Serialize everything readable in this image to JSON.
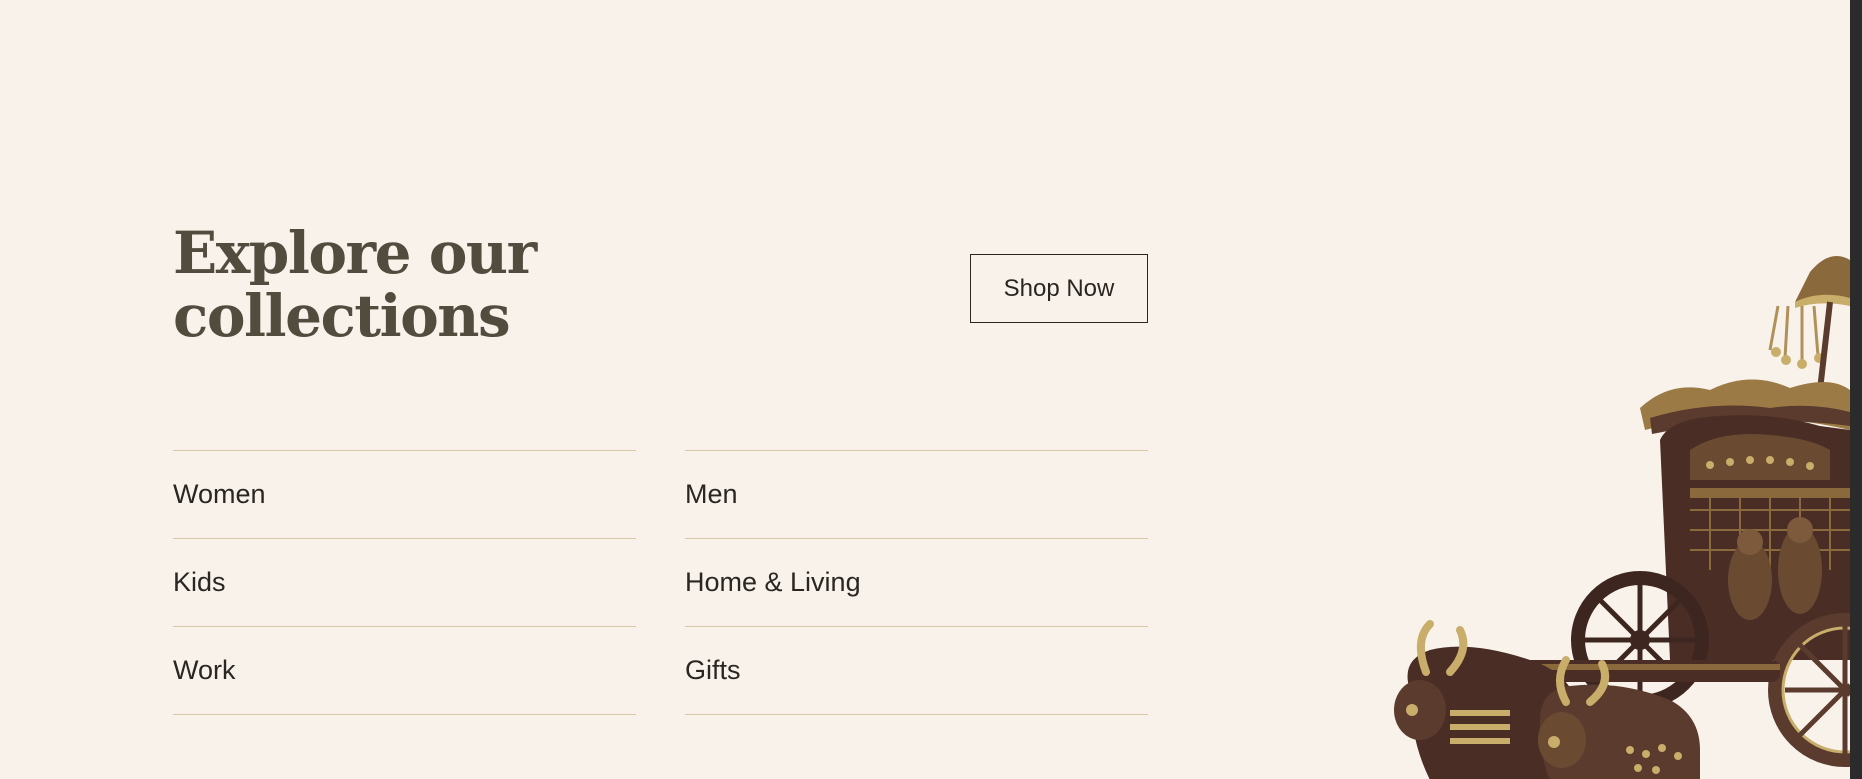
{
  "section": {
    "heading_line1": "Explore our",
    "heading_line2": "collections",
    "shop_button": "Shop Now"
  },
  "collections": {
    "left": [
      "Women",
      "Kids",
      "Work"
    ],
    "right": [
      "Men",
      "Home & Living",
      "Gifts"
    ]
  },
  "colors": {
    "background": "#f8f2eb",
    "heading": "#524c3f",
    "divider": "#d9c7a6",
    "text": "#2a2621"
  }
}
